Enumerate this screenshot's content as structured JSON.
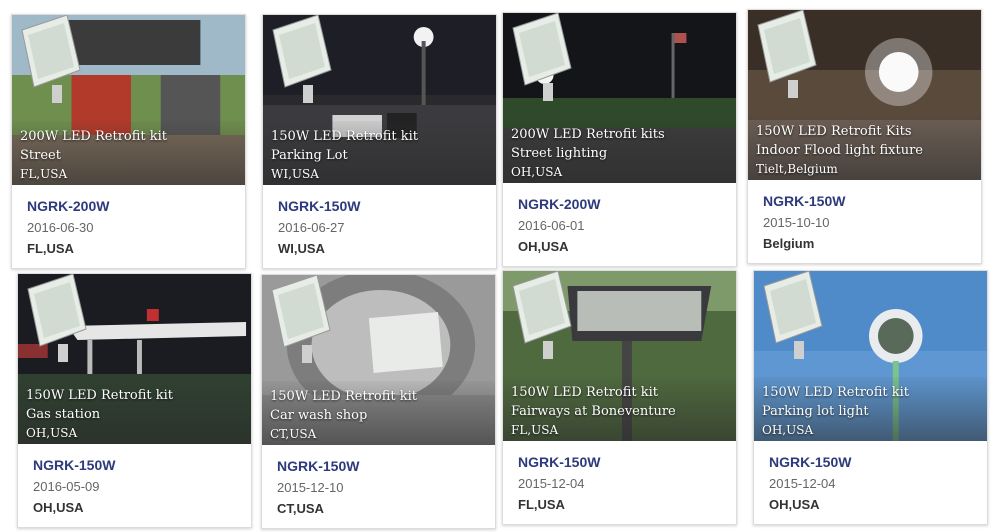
{
  "cards": [
    {
      "caption": [
        "200W LED Retrofit kit",
        "Street",
        "FL,USA"
      ],
      "model": "NGRK-200W",
      "date": "2016-06-30",
      "location": "FL,USA"
    },
    {
      "caption": [
        "150W LED Retrofit kit",
        "Parking Lot",
        "WI,USA"
      ],
      "model": "NGRK-150W",
      "date": "2016-06-27",
      "location": "WI,USA"
    },
    {
      "caption": [
        "200W LED Retrofit kits",
        "Street lighting",
        "OH,USA"
      ],
      "model": "NGRK-200W",
      "date": "2016-06-01",
      "location": "OH,USA"
    },
    {
      "caption": [
        "150W LED Retrofit Kits",
        "Indoor Flood light fixture",
        "Tielt,Belgium"
      ],
      "model": "NGRK-150W",
      "date": "2015-10-10",
      "location": "Belgium"
    },
    {
      "caption": [
        "150W LED Retrofit kit",
        "Gas station",
        "OH,USA"
      ],
      "model": "NGRK-150W",
      "date": "2016-05-09",
      "location": "OH,USA"
    },
    {
      "caption": [
        "150W LED Retrofit kit",
        "Car wash shop",
        "CT,USA"
      ],
      "model": "NGRK-150W",
      "date": "2015-12-10",
      "location": "CT,USA"
    },
    {
      "caption": [
        "150W LED Retrofit kit",
        "Fairways at Boneventure",
        "FL,USA"
      ],
      "model": "NGRK-150W",
      "date": "2015-12-04",
      "location": "FL,USA"
    },
    {
      "caption": [
        "150W LED Retrofit kit",
        "Parking lot light",
        "OH,USA"
      ],
      "model": "NGRK-150W",
      "date": "2015-12-04",
      "location": "OH,USA"
    }
  ]
}
